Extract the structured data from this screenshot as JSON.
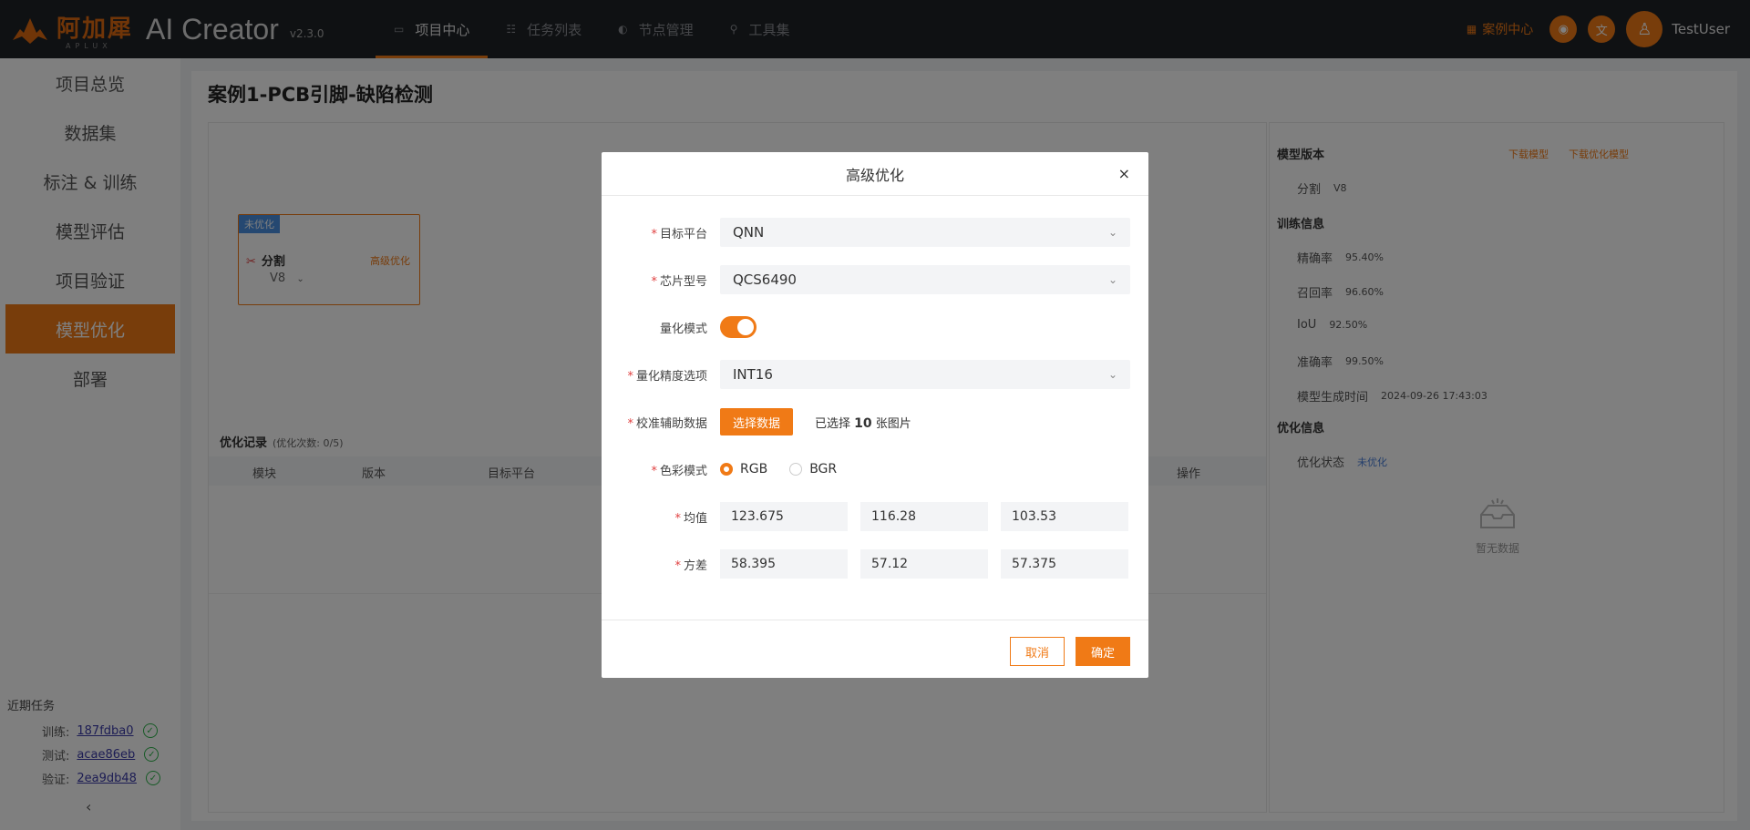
{
  "app": {
    "brand_cn": "阿加犀",
    "brand_sub": "APLUX",
    "brand_name": "AI Creator",
    "version": "v2.3.0"
  },
  "nav": [
    {
      "label": "项目中心",
      "icon": "folder-icon"
    },
    {
      "label": "任务列表",
      "icon": "list-icon"
    },
    {
      "label": "节点管理",
      "icon": "node-icon"
    },
    {
      "label": "工具集",
      "icon": "tool-icon"
    }
  ],
  "topbar": {
    "case_center": "案例中心",
    "username": "TestUser"
  },
  "sidebar": {
    "items": [
      "项目总览",
      "数据集",
      "标注 & 训练",
      "模型评估",
      "项目验证",
      "模型优化",
      "部署"
    ],
    "recent_title": "近期任务",
    "recent": [
      {
        "label": "训练:",
        "id": "187fdba0"
      },
      {
        "label": "测试:",
        "id": "acae86eb"
      },
      {
        "label": "验证:",
        "id": "2ea9db48"
      }
    ]
  },
  "page": {
    "title": "案例1-PCB引脚-缺陷检测"
  },
  "card": {
    "badge": "未优化",
    "name": "分割",
    "version": "V8",
    "action": "高级优化"
  },
  "records": {
    "title": "优化记录",
    "count": "(优化次数: 0/5)",
    "columns": [
      "模块",
      "版本",
      "目标平台",
      "操作"
    ]
  },
  "right_panel": {
    "model_version_title": "模型版本",
    "download_model": "下载模型",
    "download_optimized": "下载优化模型",
    "model_type": "分割",
    "model_ver": "V8",
    "train_info_title": "训练信息",
    "metrics": [
      {
        "label": "精确率",
        "value": "95.40%"
      },
      {
        "label": "召回率",
        "value": "96.60%"
      },
      {
        "label": "IoU",
        "value": "92.50%"
      },
      {
        "label": "准确率",
        "value": "99.50%"
      },
      {
        "label": "模型生成时间",
        "value": "2024-09-26 17:43:03"
      }
    ],
    "opt_info_title": "优化信息",
    "opt_status_label": "优化状态",
    "opt_status_value": "未优化",
    "empty_text": "暂无数据"
  },
  "modal": {
    "title": "高级优化",
    "platform_label": "目标平台",
    "platform_value": "QNN",
    "chip_label": "芯片型号",
    "chip_value": "QCS6490",
    "quant_label": "量化模式",
    "quant_on": true,
    "precision_label": "量化精度选项",
    "precision_value": "INT16",
    "calib_label": "校准辅助数据",
    "calib_button": "选择数据",
    "calib_prefix": "已选择",
    "calib_count": "10",
    "calib_suffix": "张图片",
    "color_label": "色彩模式",
    "color_options": [
      "RGB",
      "BGR"
    ],
    "color_selected": "RGB",
    "mean_label": "均值",
    "mean_values": [
      "123.675",
      "116.28",
      "103.53"
    ],
    "std_label": "方差",
    "std_values": [
      "58.395",
      "57.12",
      "57.375"
    ],
    "cancel": "取消",
    "confirm": "确定"
  },
  "colors": {
    "accent": "#f07a16",
    "topbar": "#1f2227"
  }
}
